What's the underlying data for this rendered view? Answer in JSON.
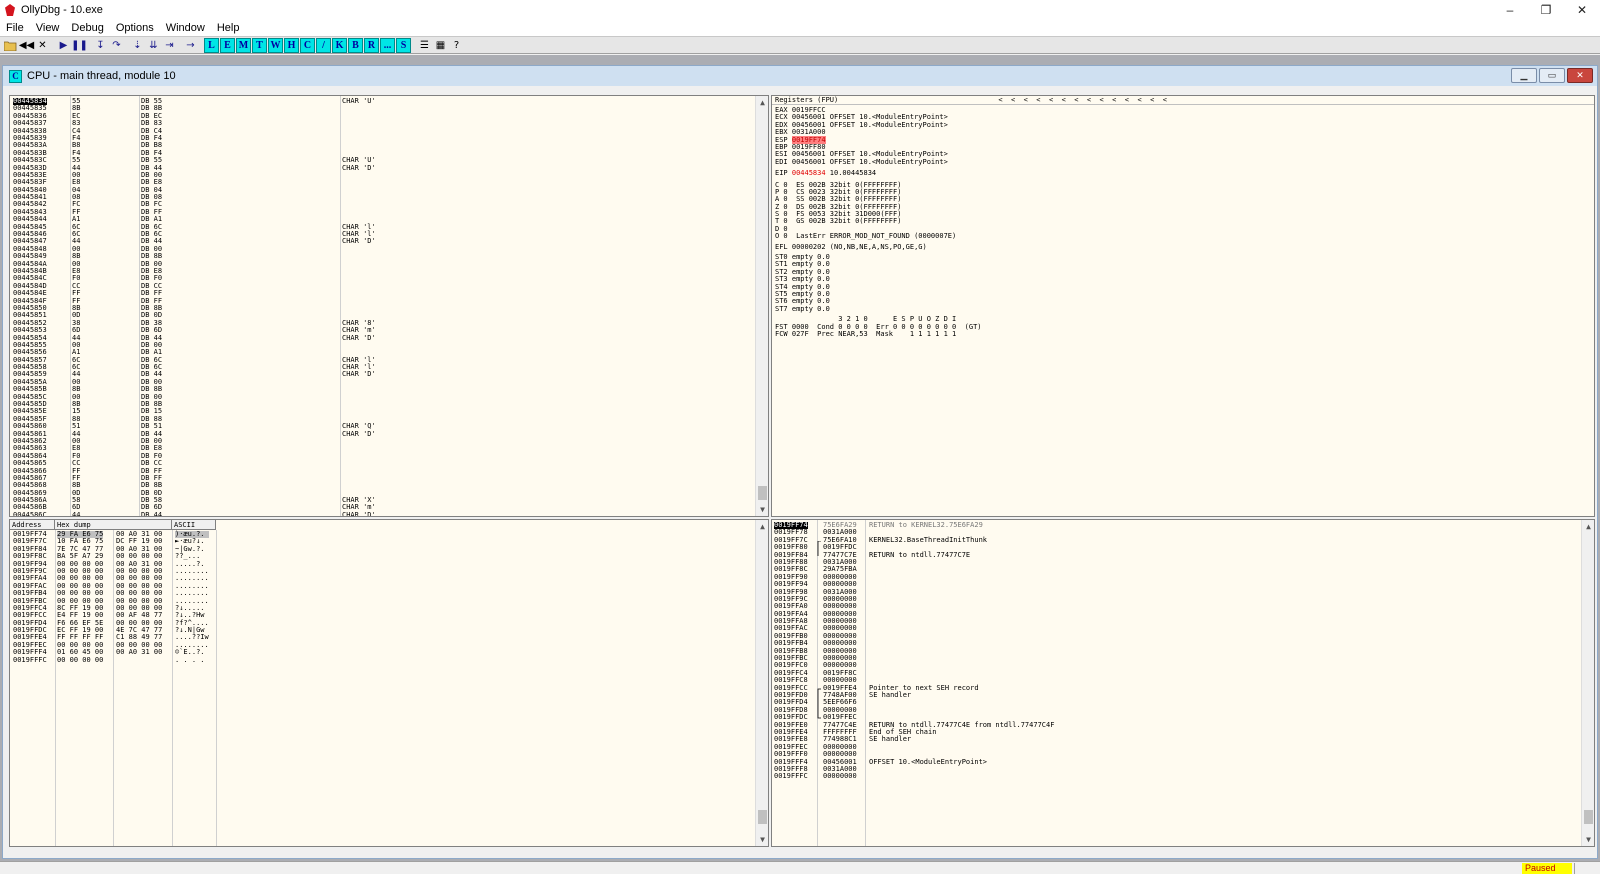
{
  "app": {
    "title": "OllyDbg - 10.exe",
    "window_controls": [
      "–",
      "❐",
      "✕"
    ]
  },
  "menu": [
    "File",
    "View",
    "Debug",
    "Options",
    "Window",
    "Help"
  ],
  "toolbar": {
    "letters": [
      "L",
      "E",
      "M",
      "T",
      "W",
      "H",
      "C",
      "/",
      "K",
      "B",
      "R",
      "...",
      "S"
    ]
  },
  "cpu_window": {
    "title": "CPU - main thread, module 10",
    "icon_letter": "C"
  },
  "disasm": {
    "rows": [
      [
        "00445834",
        "55",
        "DB 55",
        "CHAR 'U'"
      ],
      [
        "00445835",
        "8B",
        "DB 8B",
        ""
      ],
      [
        "00445836",
        "EC",
        "DB EC",
        ""
      ],
      [
        "00445837",
        "83",
        "DB 83",
        ""
      ],
      [
        "00445838",
        "C4",
        "DB C4",
        ""
      ],
      [
        "00445839",
        "F4",
        "DB F4",
        ""
      ],
      [
        "0044583A",
        "B8",
        "DB B8",
        ""
      ],
      [
        "0044583B",
        "F4",
        "DB F4",
        ""
      ],
      [
        "0044583C",
        "55",
        "DB 55",
        "CHAR 'U'"
      ],
      [
        "0044583D",
        "44",
        "DB 44",
        "CHAR 'D'"
      ],
      [
        "0044583E",
        "00",
        "DB 00",
        ""
      ],
      [
        "0044583F",
        "E8",
        "DB E8",
        ""
      ],
      [
        "00445840",
        "04",
        "DB 04",
        ""
      ],
      [
        "00445841",
        "08",
        "DB 08",
        ""
      ],
      [
        "00445842",
        "FC",
        "DB FC",
        ""
      ],
      [
        "00445843",
        "FF",
        "DB FF",
        ""
      ],
      [
        "00445844",
        "A1",
        "DB A1",
        ""
      ],
      [
        "00445845",
        "6C",
        "DB 6C",
        "CHAR 'l'"
      ],
      [
        "00445846",
        "6C",
        "DB 6C",
        "CHAR 'l'"
      ],
      [
        "00445847",
        "44",
        "DB 44",
        "CHAR 'D'"
      ],
      [
        "00445848",
        "00",
        "DB 00",
        ""
      ],
      [
        "00445849",
        "8B",
        "DB 8B",
        ""
      ],
      [
        "0044584A",
        "00",
        "DB 00",
        ""
      ],
      [
        "0044584B",
        "E8",
        "DB E8",
        ""
      ],
      [
        "0044584C",
        "F0",
        "DB F0",
        ""
      ],
      [
        "0044584D",
        "CC",
        "DB CC",
        ""
      ],
      [
        "0044584E",
        "FF",
        "DB FF",
        ""
      ],
      [
        "0044584F",
        "FF",
        "DB FF",
        ""
      ],
      [
        "00445850",
        "8B",
        "DB 8B",
        ""
      ],
      [
        "00445851",
        "0D",
        "DB 0D",
        ""
      ],
      [
        "00445852",
        "38",
        "DB 38",
        "CHAR '8'"
      ],
      [
        "00445853",
        "6D",
        "DB 6D",
        "CHAR 'm'"
      ],
      [
        "00445854",
        "44",
        "DB 44",
        "CHAR 'D'"
      ],
      [
        "00445855",
        "00",
        "DB 00",
        ""
      ],
      [
        "00445856",
        "A1",
        "DB A1",
        ""
      ],
      [
        "00445857",
        "6C",
        "DB 6C",
        "CHAR 'l'"
      ],
      [
        "00445858",
        "6C",
        "DB 6C",
        "CHAR 'l'"
      ],
      [
        "00445859",
        "44",
        "DB 44",
        "CHAR 'D'"
      ],
      [
        "0044585A",
        "00",
        "DB 00",
        ""
      ],
      [
        "0044585B",
        "8B",
        "DB 8B",
        ""
      ],
      [
        "0044585C",
        "00",
        "DB 00",
        ""
      ],
      [
        "0044585D",
        "8B",
        "DB 8B",
        ""
      ],
      [
        "0044585E",
        "15",
        "DB 15",
        ""
      ],
      [
        "0044585F",
        "88",
        "DB 88",
        ""
      ],
      [
        "00445860",
        "51",
        "DB 51",
        "CHAR 'Q'"
      ],
      [
        "00445861",
        "44",
        "DB 44",
        "CHAR 'D'"
      ],
      [
        "00445862",
        "00",
        "DB 00",
        ""
      ],
      [
        "00445863",
        "E8",
        "DB E8",
        ""
      ],
      [
        "00445864",
        "F0",
        "DB F0",
        ""
      ],
      [
        "00445865",
        "CC",
        "DB CC",
        ""
      ],
      [
        "00445866",
        "FF",
        "DB FF",
        ""
      ],
      [
        "00445867",
        "FF",
        "DB FF",
        ""
      ],
      [
        "00445868",
        "8B",
        "DB 8B",
        ""
      ],
      [
        "00445869",
        "0D",
        "DB 0D",
        ""
      ],
      [
        "0044586A",
        "58",
        "DB 58",
        "CHAR 'X'"
      ],
      [
        "0044586B",
        "6D",
        "DB 6D",
        "CHAR 'm'"
      ],
      [
        "0044586C",
        "44",
        "DB 44",
        "CHAR 'D'"
      ]
    ]
  },
  "registers": {
    "header": "Registers (FPU)",
    "header_arrows": "<  <  <  <  <  <  <  <  <  <  <  <  <  <",
    "gp": [
      "EAX 0019FFCC",
      "ECX 00456001 OFFSET 10.<ModuleEntryPoint>",
      "EDX 00456001 OFFSET 10.<ModuleEntryPoint>",
      "EBX 0031A000"
    ],
    "esp_label": "ESP ",
    "esp_value": "0019FF74",
    "gp2": [
      "EBP 0019FF80",
      "ESI 00456001 OFFSET 10.<ModuleEntryPoint>",
      "EDI 00456001 OFFSET 10.<ModuleEntryPoint>"
    ],
    "eip_label": "EIP ",
    "eip_value": "00445834",
    "eip_suffix": " 10.00445834",
    "flags": [
      "C 0  ES 002B 32bit 0(FFFFFFFF)",
      "P 0  CS 0023 32bit 0(FFFFFFFF)",
      "A 0  SS 002B 32bit 0(FFFFFFFF)",
      "Z 0  DS 002B 32bit 0(FFFFFFFF)",
      "S 0  FS 0053 32bit 31D000(FFF)",
      "T 0  GS 002B 32bit 0(FFFFFFFF)",
      "D 0",
      "O 0  LastErr ERROR_MOD_NOT_FOUND (0000007E)"
    ],
    "efl": "EFL 00000202 (NO,NB,NE,A,NS,PO,GE,G)",
    "fpu": [
      "ST0 empty 0.0",
      "ST1 empty 0.0",
      "ST2 empty 0.0",
      "ST3 empty 0.0",
      "ST4 empty 0.0",
      "ST5 empty 0.0",
      "ST6 empty 0.0",
      "ST7 empty 0.0"
    ],
    "fpu_hdr": "               3 2 1 0      E S P U O Z D I",
    "fst": "FST 0000  Cond 0 0 0 0  Err 0 0 0 0 0 0 0 0  (GT)",
    "fcw": "FCW 027F  Prec NEAR,53  Mask    1 1 1 1 1 1"
  },
  "dump": {
    "headers": [
      "Address",
      "Hex dump",
      "ASCII"
    ],
    "rows": [
      [
        "0019FF74",
        "29 FA E6 75",
        "00 A0 31 00",
        ")·æu.?."
      ],
      [
        "0019FF7C",
        "10 FA E6 75",
        "DC FF 19 00",
        "►·æu?↓."
      ],
      [
        "0019FF84",
        "7E 7C 47 77",
        "00 A0 31 00",
        "~|Gw.?."
      ],
      [
        "0019FF8C",
        "BA 5F A7 29",
        "00 00 00 00",
        "??_..."
      ],
      [
        "0019FF94",
        "00 00 00 00",
        "00 A0 31 00",
        ".....?."
      ],
      [
        "0019FF9C",
        "00 00 00 00",
        "00 00 00 00",
        "........"
      ],
      [
        "0019FFA4",
        "00 00 00 00",
        "00 00 00 00",
        "........"
      ],
      [
        "0019FFAC",
        "00 00 00 00",
        "00 00 00 00",
        "........"
      ],
      [
        "0019FFB4",
        "00 00 00 00",
        "00 00 00 00",
        "........"
      ],
      [
        "0019FFBC",
        "00 00 00 00",
        "00 00 00 00",
        "........"
      ],
      [
        "0019FFC4",
        "8C FF 19 00",
        "00 00 00 00",
        "?↓....."
      ],
      [
        "0019FFCC",
        "E4 FF 19 00",
        "00 AF 48 77",
        "?↓..?Hw"
      ],
      [
        "0019FFD4",
        "F6 66 EF 5E",
        "00 00 00 00",
        "?f?^...."
      ],
      [
        "0019FFDC",
        "EC FF 19 00",
        "4E 7C 47 77",
        "?↓.N|Gw"
      ],
      [
        "0019FFE4",
        "FF FF FF FF",
        "C1 88 49 77",
        "....??Iw"
      ],
      [
        "0019FFEC",
        "00 00 00 00",
        "00 00 00 00",
        "........"
      ],
      [
        "0019FFF4",
        "01 60 45 00",
        "00 A0 31 00",
        "☺`E..?."
      ],
      [
        "0019FFFC",
        "00 00 00 00",
        "",
        ". . . ."
      ]
    ]
  },
  "stack": {
    "rows": [
      [
        "0019FF74",
        "75E6FA29",
        "",
        "RETURN to KERNEL32.75E6FA29"
      ],
      [
        "0019FF78",
        "0031A000",
        "",
        ""
      ],
      [
        "0019FF7C",
        "75E6FA10",
        "",
        "KERNEL32.BaseThreadInitThunk"
      ],
      [
        "0019FF80",
        "0019FFDC",
        "",
        ""
      ],
      [
        "0019FF84",
        "77477C7E",
        "",
        "RETURN to ntdll.77477C7E"
      ],
      [
        "0019FF88",
        "0031A000",
        "",
        ""
      ],
      [
        "0019FF8C",
        "29A75FBA",
        "",
        ""
      ],
      [
        "0019FF90",
        "00000000",
        "",
        ""
      ],
      [
        "0019FF94",
        "00000000",
        "",
        ""
      ],
      [
        "0019FF98",
        "0031A000",
        "",
        ""
      ],
      [
        "0019FF9C",
        "00000000",
        "",
        ""
      ],
      [
        "0019FFA0",
        "00000000",
        "",
        ""
      ],
      [
        "0019FFA4",
        "00000000",
        "",
        ""
      ],
      [
        "0019FFA8",
        "00000000",
        "",
        ""
      ],
      [
        "0019FFAC",
        "00000000",
        "",
        ""
      ],
      [
        "0019FFB0",
        "00000000",
        "",
        ""
      ],
      [
        "0019FFB4",
        "00000000",
        "",
        ""
      ],
      [
        "0019FFB8",
        "00000000",
        "",
        ""
      ],
      [
        "0019FFBC",
        "00000000",
        "",
        ""
      ],
      [
        "0019FFC0",
        "00000000",
        "",
        ""
      ],
      [
        "0019FFC4",
        "0019FF8C",
        "",
        ""
      ],
      [
        "0019FFC8",
        "00000000",
        "",
        ""
      ],
      [
        "0019FFCC",
        "0019FFE4",
        "",
        "Pointer to next SEH record"
      ],
      [
        "0019FFD0",
        "7748AF00",
        "",
        "SE handler"
      ],
      [
        "0019FFD4",
        "5EEF66F6",
        "",
        ""
      ],
      [
        "0019FFD8",
        "00000000",
        "",
        ""
      ],
      [
        "0019FFDC",
        "0019FFEC",
        "",
        ""
      ],
      [
        "0019FFE0",
        "77477C4E",
        "",
        "RETURN to ntdll.77477C4E from ntdll.77477C4F"
      ],
      [
        "0019FFE4",
        "FFFFFFFF",
        "",
        "End of SEH chain"
      ],
      [
        "0019FFE8",
        "774988C1",
        "",
        "SE handler"
      ],
      [
        "0019FFEC",
        "00000000",
        "",
        ""
      ],
      [
        "0019FFF0",
        "00000000",
        "",
        ""
      ],
      [
        "0019FFF4",
        "00456001",
        "",
        "OFFSET 10.<ModuleEntryPoint>"
      ],
      [
        "0019FFF8",
        "0031A000",
        "",
        ""
      ],
      [
        "0019FFFC",
        "00000000",
        "",
        ""
      ]
    ]
  },
  "status": {
    "paused": "Paused"
  }
}
